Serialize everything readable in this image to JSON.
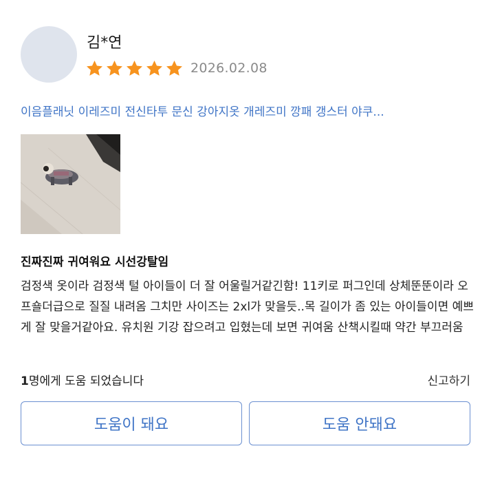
{
  "review": {
    "reviewer_name": "김*연",
    "rating": 5,
    "date": "2026.02.08",
    "product_link": "이음플래닛 이레즈미 전신타투 문신 강아지옷 개레즈미 깡패 갱스터 야쿠...",
    "title": "진짜진짜 귀여워요 시선강탈임",
    "body": "검정색 옷이라 검정색 털 아이들이 더 잘 어울릴거같긴함! 11키로 퍼그인데 상체뚠뚠이라 오프숄더급으로 질질 내려옴 그치만 사이즈는 2xl가 맞을듯..목 길이가 좀 있는 아이들이면 예쁘게 잘 맞을거같아요. 유치원 기강 잡으려고 입혔는데 보면 귀여움 산책시킬때 약간 부끄러움",
    "helpful_count": "1",
    "helpful_suffix": "명에게 도움 되었습니다",
    "report_label": "신고하기",
    "helpful_yes_label": "도움이 돼요",
    "helpful_no_label": "도움 안돼요"
  },
  "colors": {
    "accent": "#3f74c6",
    "star": "#f7931e",
    "date": "#8a8a8a",
    "avatar": "#dfe4ed"
  },
  "icons": {
    "star": "star-icon"
  }
}
